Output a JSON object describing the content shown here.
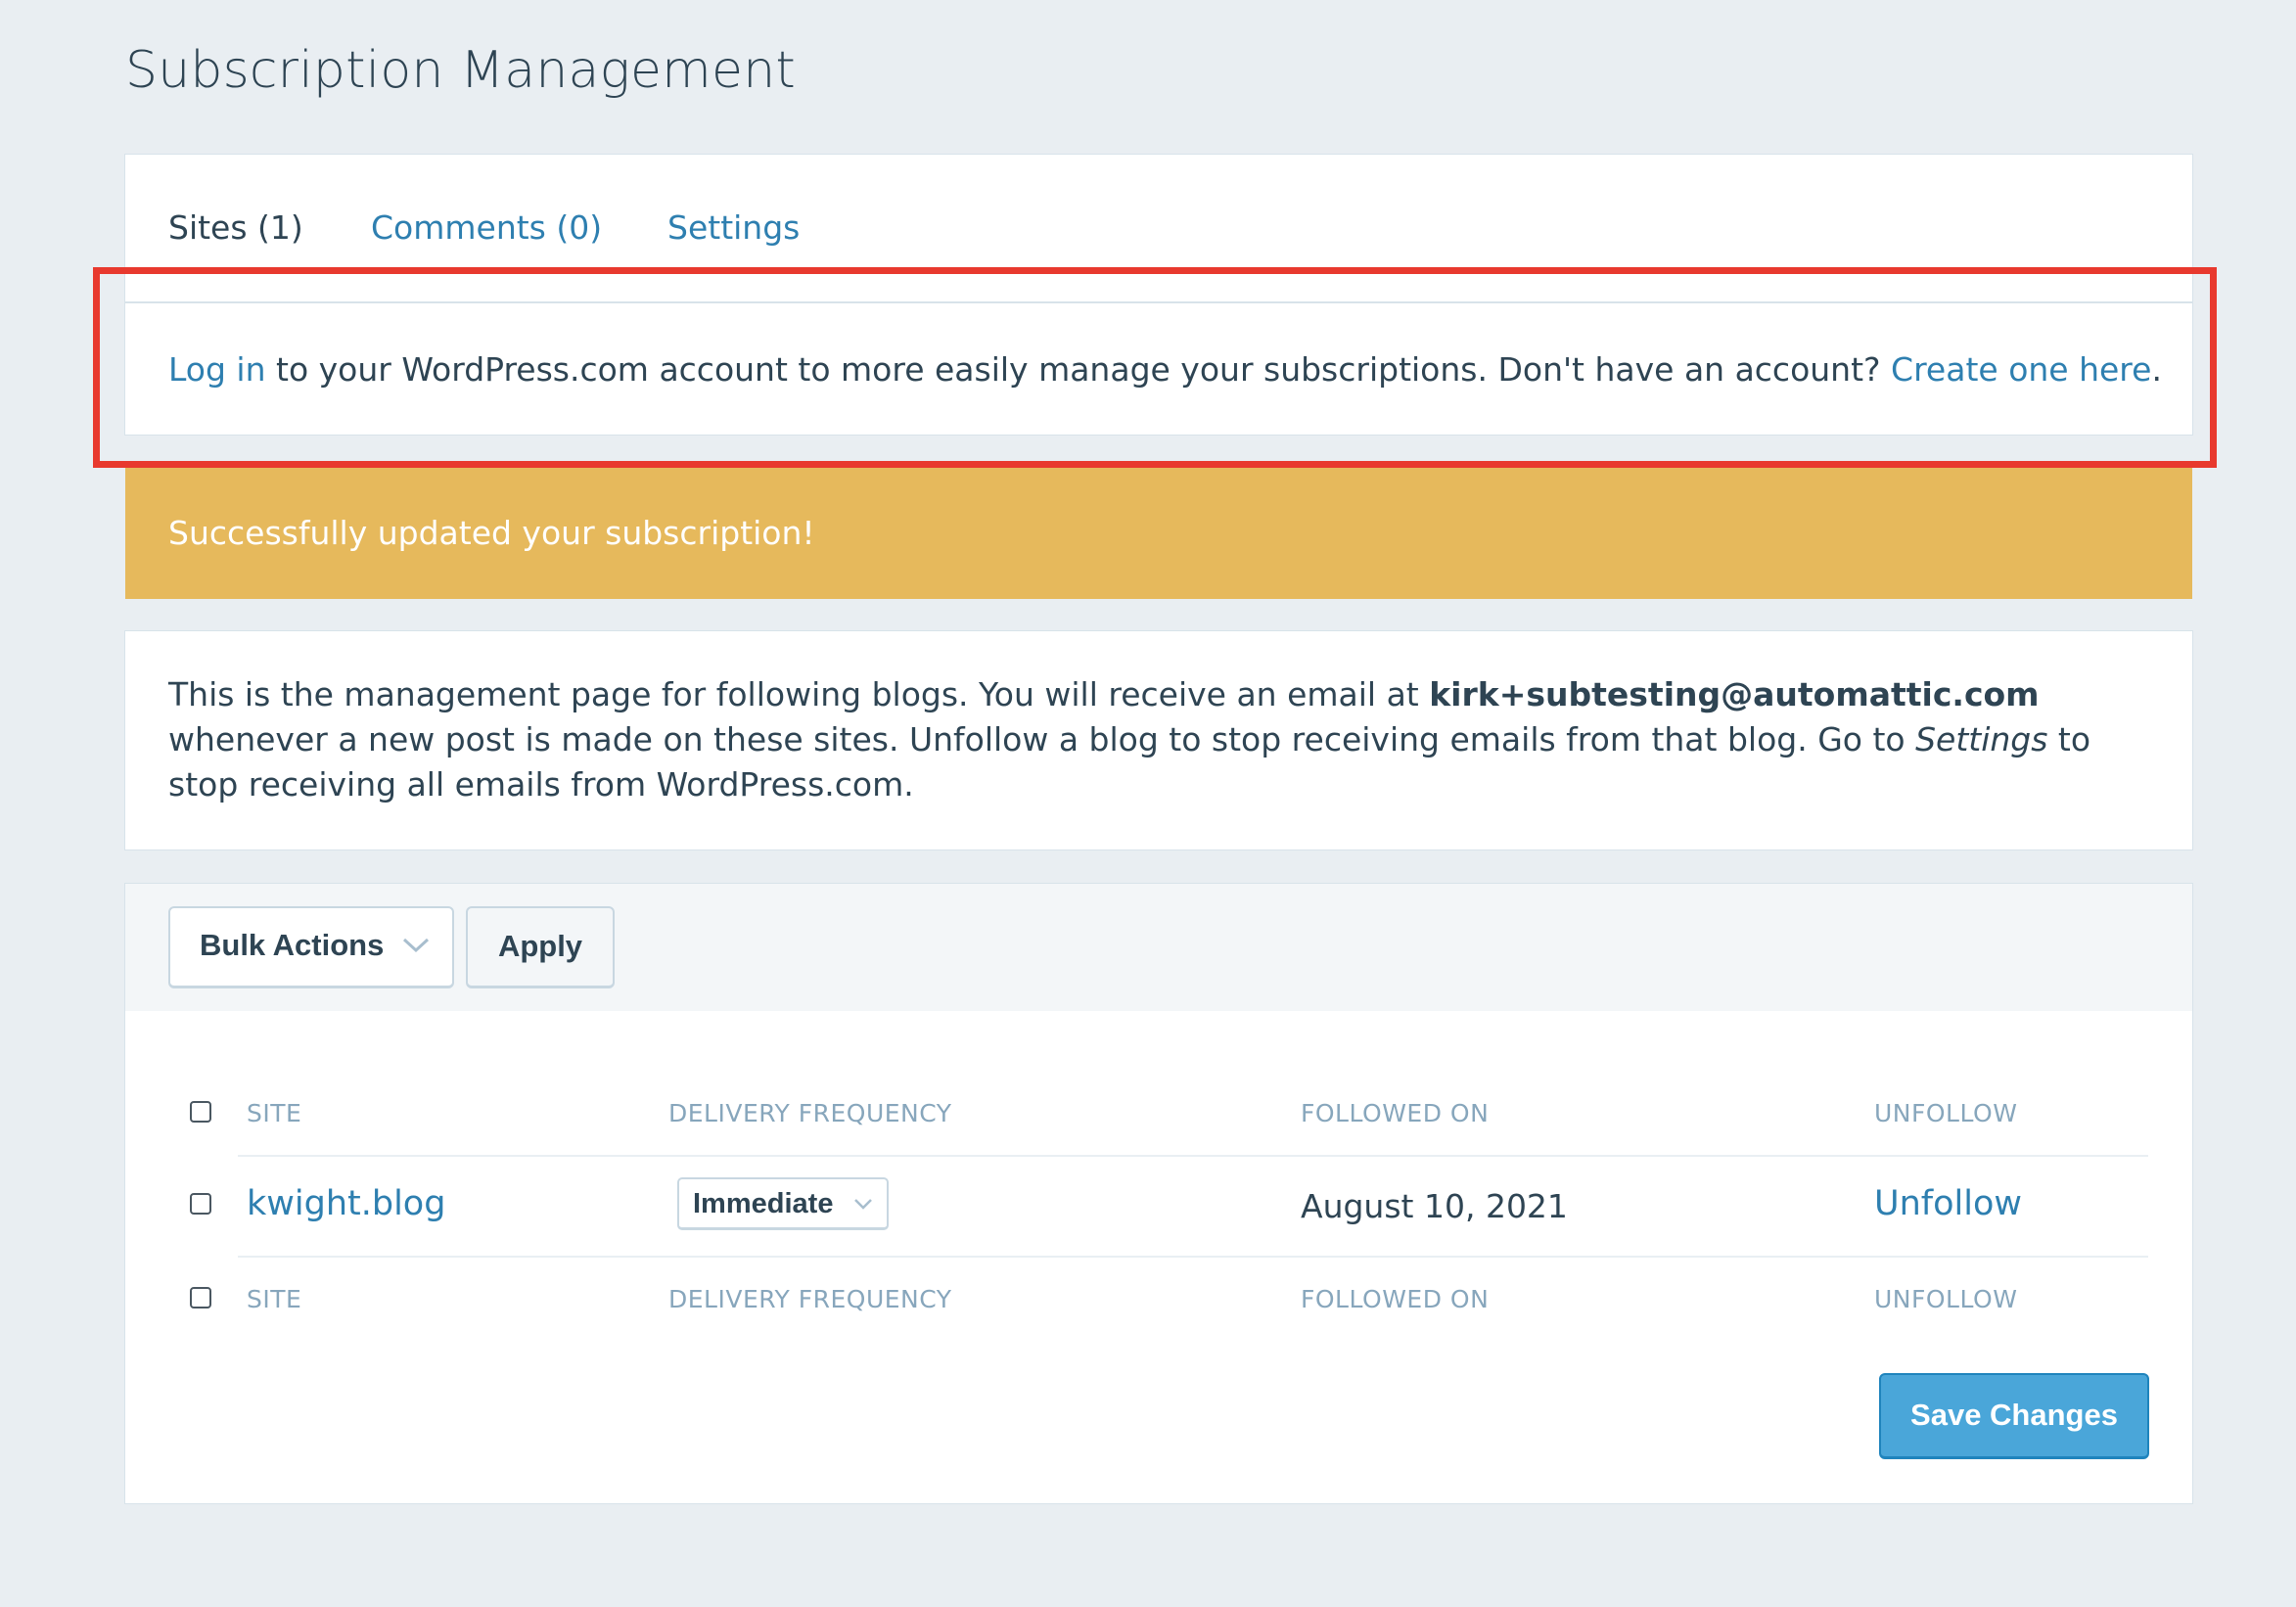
{
  "page": {
    "title": "Subscription Management"
  },
  "tabs": [
    {
      "label": "Sites (1)",
      "active": true
    },
    {
      "label": "Comments (0)",
      "active": false
    },
    {
      "label": "Settings",
      "active": false
    }
  ],
  "login_notice": {
    "login_link": "Log in",
    "middle_text": " to your WordPress.com account to more easily manage your subscriptions. Don't have an account? ",
    "create_link": "Create one here",
    "end_text": "."
  },
  "success_notice": {
    "text": "Successfully updated your subscription!"
  },
  "description": {
    "part1": "This is the management page for following blogs. You will receive an email at ",
    "email": "kirk+subtesting@automattic.com",
    "part2": " whenever a new post is made on these sites. Unfollow a blog to stop receiving emails from that blog. Go to ",
    "settings_word": "Settings",
    "part3": " to stop receiving all emails from WordPress.com."
  },
  "bulk": {
    "select_label": "Bulk Actions",
    "apply_label": "Apply"
  },
  "table": {
    "headers": [
      "SITE",
      "DELIVERY FREQUENCY",
      "FOLLOWED ON",
      "UNFOLLOW"
    ],
    "rows": [
      {
        "site": "kwight.blog",
        "frequency": "Immediate",
        "followed_on": "August 10, 2021",
        "unfollow": "Unfollow"
      }
    ],
    "footer_headers": [
      "SITE",
      "DELIVERY FREQUENCY",
      "FOLLOWED ON",
      "UNFOLLOW"
    ]
  },
  "save_label": "Save Changes",
  "colors": {
    "background": "#e9eef2",
    "link": "#2e7fb0",
    "notice": "#e6b95c",
    "highlight": "#e8392e",
    "primary_button": "#4aa6d9"
  }
}
